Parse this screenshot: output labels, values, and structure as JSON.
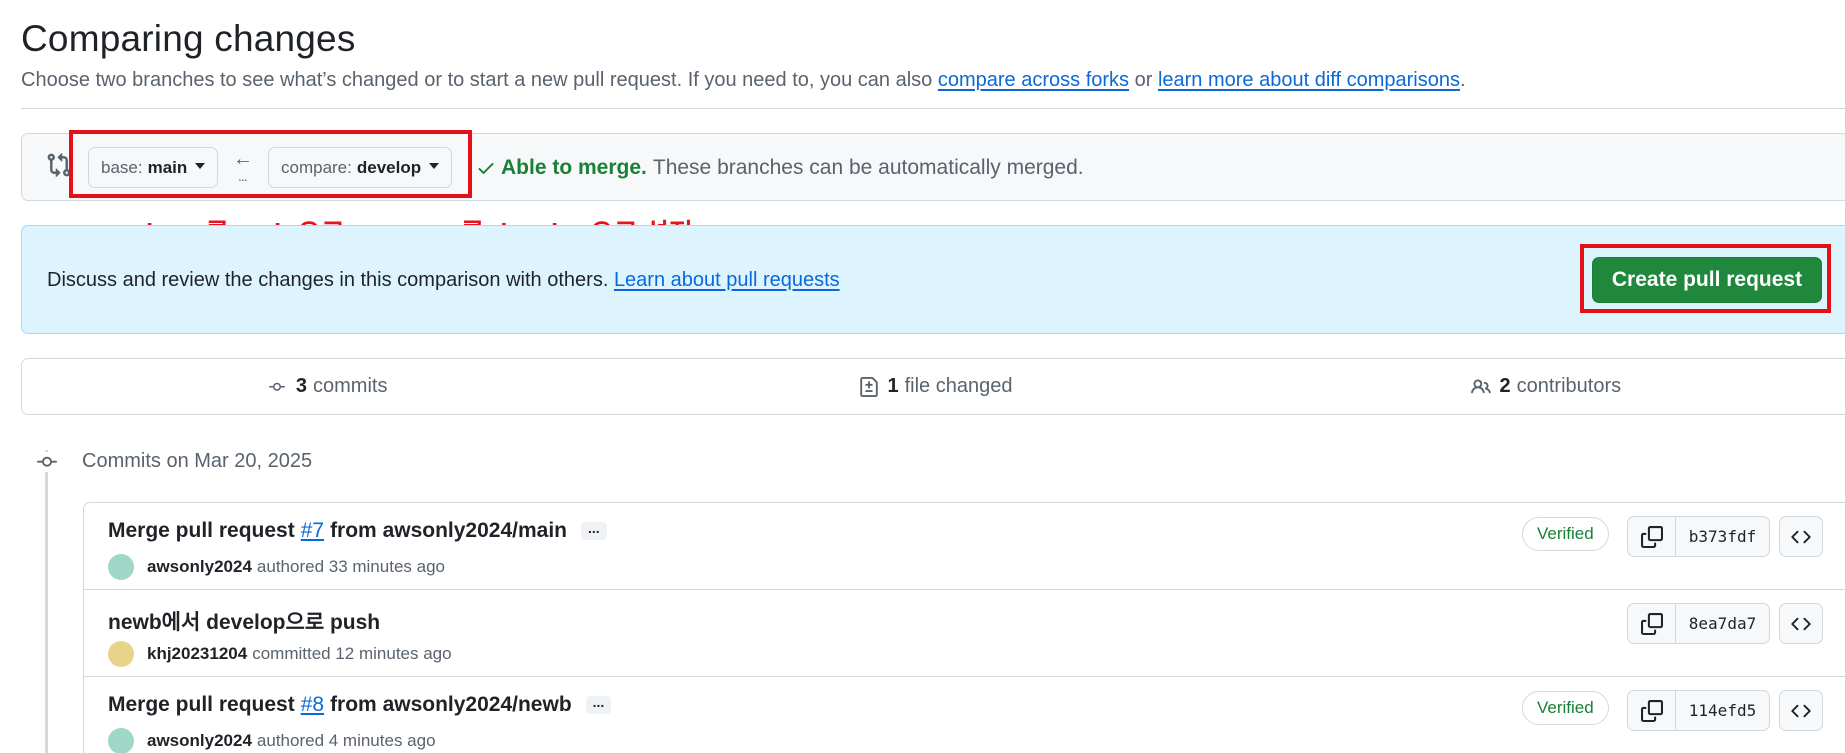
{
  "header": {
    "title": "Comparing changes",
    "subtitle_prefix": "Choose two branches to see what’s changed or to start a new pull request. If you need to, you can also ",
    "subtitle_link1": "compare across forks",
    "subtitle_mid": " or ",
    "subtitle_link2": "learn more about diff comparisons",
    "subtitle_suffix": "."
  },
  "range": {
    "base_prefix": "base:",
    "base_branch": "main",
    "compare_prefix": "compare:",
    "compare_branch": "develop",
    "arrow": "←",
    "dots": "...",
    "merge_ok": "Able to merge.",
    "merge_text": "These branches can be automatically merged."
  },
  "annotation": {
    "text": "base를 main으로 compare를 develop으로 설정",
    "color": "#e3101a"
  },
  "flash": {
    "text": "Discuss and review the changes in this comparison with others. ",
    "link": "Learn about pull requests",
    "button": "Create pull request"
  },
  "stats": {
    "commits_count": "3",
    "commits_label": "commits",
    "files_count": "1",
    "files_label": "file changed",
    "contributors_count": "2",
    "contributors_label": "contributors"
  },
  "timeline": {
    "date_label": "Commits on Mar 20, 2025"
  },
  "commits": [
    {
      "title_pre": "Merge pull request",
      "pr": "#7",
      "title_post": "from awsonly2024/main",
      "ellipsis": "...",
      "author": "awsonly2024",
      "action": "authored 33 minutes ago",
      "verified": "Verified",
      "sha": "b373fdf",
      "avatar_color": "#9fd8c8"
    },
    {
      "title_pre": "newb에서 develop으로 push",
      "pr": "",
      "title_post": "",
      "ellipsis": "",
      "author": "khj20231204",
      "action": "committed 12 minutes ago",
      "verified": "",
      "sha": "8ea7da7",
      "avatar_color": "#e8d38a"
    },
    {
      "title_pre": "Merge pull request",
      "pr": "#8",
      "title_post": "from awsonly2024/newb",
      "ellipsis": "...",
      "author": "awsonly2024",
      "action": "authored 4 minutes ago",
      "verified": "Verified",
      "sha": "114efd5",
      "avatar_color": "#9fd8c8"
    }
  ],
  "colors": {
    "primary_button": "#1f883d",
    "link": "#0969da",
    "success": "#1a7f37",
    "flash_bg": "#ddf4ff"
  },
  "icons": {
    "compare": "git-compare-icon",
    "check": "check-icon",
    "commit": "git-commit-icon",
    "file_diff": "file-diff-icon",
    "people": "people-icon",
    "copy": "copy-icon",
    "code": "code-icon"
  }
}
